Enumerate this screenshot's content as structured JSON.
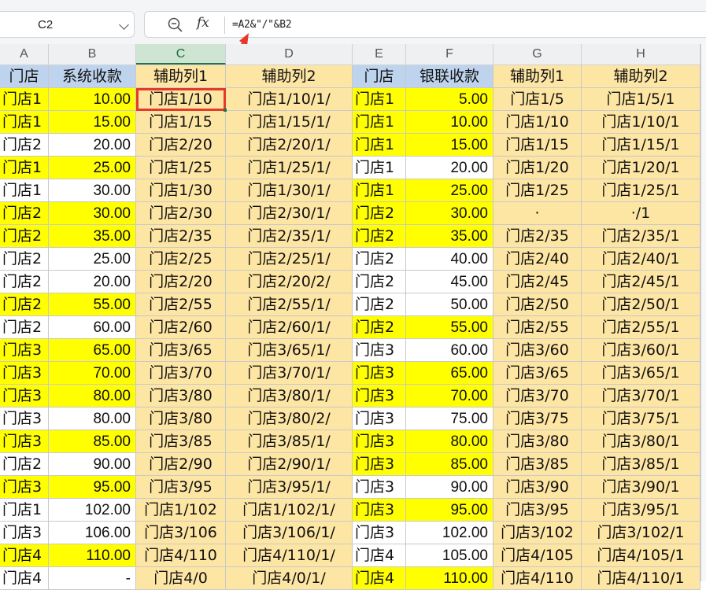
{
  "name_box": {
    "value": "C2"
  },
  "formula_bar": {
    "formula": "=A2&\"/\"&B2",
    "fx_label": "fx"
  },
  "columns": [
    "A",
    "B",
    "C",
    "D",
    "E",
    "F",
    "G",
    "H"
  ],
  "active_column": "C",
  "selected_cell": "C2",
  "header_row": [
    "门店",
    "系统收款",
    "辅助列1",
    "辅助列2",
    "门店",
    "银联收款",
    "辅助列1",
    "辅助列2"
  ],
  "rows": [
    {
      "a": "门店1",
      "b": "10.00",
      "c": "门店1/10",
      "d": "门店1/10/1/",
      "e": "门店1",
      "f": "5.00",
      "g": "门店1/5",
      "h": "门店1/5/1",
      "ya": true,
      "ye": true
    },
    {
      "a": "门店1",
      "b": "15.00",
      "c": "门店1/15",
      "d": "门店1/15/1/",
      "e": "门店1",
      "f": "10.00",
      "g": "门店1/10",
      "h": "门店1/10/1",
      "ya": true,
      "ye": true
    },
    {
      "a": "门店2",
      "b": "20.00",
      "c": "门店2/20",
      "d": "门店2/20/1/",
      "e": "门店1",
      "f": "15.00",
      "g": "门店1/15",
      "h": "门店1/15/1",
      "ya": false,
      "ye": true
    },
    {
      "a": "门店1",
      "b": "25.00",
      "c": "门店1/25",
      "d": "门店1/25/1/",
      "e": "门店1",
      "f": "20.00",
      "g": "门店1/20",
      "h": "门店1/20/1",
      "ya": true,
      "ye": false
    },
    {
      "a": "门店1",
      "b": "30.00",
      "c": "门店1/30",
      "d": "门店1/30/1/",
      "e": "门店1",
      "f": "25.00",
      "g": "门店1/25",
      "h": "门店1/25/1",
      "ya": false,
      "ye": true
    },
    {
      "a": "门店2",
      "b": "30.00",
      "c": "门店2/30",
      "d": "门店2/30/1/",
      "e": "门店2",
      "f": "30.00",
      "g": "·",
      "h": "·/1",
      "ya": true,
      "ye": true
    },
    {
      "a": "门店2",
      "b": "35.00",
      "c": "门店2/35",
      "d": "门店2/35/1/",
      "e": "门店2",
      "f": "35.00",
      "g": "门店2/35",
      "h": "门店2/35/1",
      "ya": true,
      "ye": true
    },
    {
      "a": "门店2",
      "b": "25.00",
      "c": "门店2/25",
      "d": "门店2/25/1/",
      "e": "门店2",
      "f": "40.00",
      "g": "门店2/40",
      "h": "门店2/40/1",
      "ya": false,
      "ye": false
    },
    {
      "a": "门店2",
      "b": "20.00",
      "c": "门店2/20",
      "d": "门店2/20/2/",
      "e": "门店2",
      "f": "45.00",
      "g": "门店2/45",
      "h": "门店2/45/1",
      "ya": false,
      "ye": false
    },
    {
      "a": "门店2",
      "b": "55.00",
      "c": "门店2/55",
      "d": "门店2/55/1/",
      "e": "门店2",
      "f": "50.00",
      "g": "门店2/50",
      "h": "门店2/50/1",
      "ya": true,
      "ye": false
    },
    {
      "a": "门店2",
      "b": "60.00",
      "c": "门店2/60",
      "d": "门店2/60/1/",
      "e": "门店2",
      "f": "55.00",
      "g": "门店2/55",
      "h": "门店2/55/1",
      "ya": false,
      "ye": true
    },
    {
      "a": "门店3",
      "b": "65.00",
      "c": "门店3/65",
      "d": "门店3/65/1/",
      "e": "门店3",
      "f": "60.00",
      "g": "门店3/60",
      "h": "门店3/60/1",
      "ya": true,
      "ye": false
    },
    {
      "a": "门店3",
      "b": "70.00",
      "c": "门店3/70",
      "d": "门店3/70/1/",
      "e": "门店3",
      "f": "65.00",
      "g": "门店3/65",
      "h": "门店3/65/1",
      "ya": true,
      "ye": true
    },
    {
      "a": "门店3",
      "b": "80.00",
      "c": "门店3/80",
      "d": "门店3/80/1/",
      "e": "门店3",
      "f": "70.00",
      "g": "门店3/70",
      "h": "门店3/70/1",
      "ya": true,
      "ye": true
    },
    {
      "a": "门店3",
      "b": "80.00",
      "c": "门店3/80",
      "d": "门店3/80/2/",
      "e": "门店3",
      "f": "75.00",
      "g": "门店3/75",
      "h": "门店3/75/1",
      "ya": false,
      "ye": false
    },
    {
      "a": "门店3",
      "b": "85.00",
      "c": "门店3/85",
      "d": "门店3/85/1/",
      "e": "门店3",
      "f": "80.00",
      "g": "门店3/80",
      "h": "门店3/80/1",
      "ya": true,
      "ye": true
    },
    {
      "a": "门店2",
      "b": "90.00",
      "c": "门店2/90",
      "d": "门店2/90/1/",
      "e": "门店3",
      "f": "85.00",
      "g": "门店3/85",
      "h": "门店3/85/1",
      "ya": false,
      "ye": true
    },
    {
      "a": "门店3",
      "b": "95.00",
      "c": "门店3/95",
      "d": "门店3/95/1/",
      "e": "门店3",
      "f": "90.00",
      "g": "门店3/90",
      "h": "门店3/90/1",
      "ya": true,
      "ye": false
    },
    {
      "a": "门店1",
      "b": "102.00",
      "c": "门店1/102",
      "d": "门店1/102/1/",
      "e": "门店3",
      "f": "95.00",
      "g": "门店3/95",
      "h": "门店3/95/1",
      "ya": false,
      "ye": true
    },
    {
      "a": "门店3",
      "b": "106.00",
      "c": "门店3/106",
      "d": "门店3/106/1/",
      "e": "门店3",
      "f": "102.00",
      "g": "门店3/102",
      "h": "门店3/102/1",
      "ya": false,
      "ye": false
    },
    {
      "a": "门店4",
      "b": "110.00",
      "c": "门店4/110",
      "d": "门店4/110/1/",
      "e": "门店4",
      "f": "105.00",
      "g": "门店4/105",
      "h": "门店4/105/1",
      "ya": true,
      "ye": false
    },
    {
      "a": "门店4",
      "b": "-",
      "c": "门店4/0",
      "d": "门店4/0/1/",
      "e": "门店4",
      "f": "110.00",
      "g": "门店4/110",
      "h": "门店4/110/1",
      "ya": false,
      "ye": true
    }
  ],
  "colors": {
    "yellow": "#ffff00",
    "helper_orange": "#fde5a4",
    "header_blue": "#bed4ee",
    "selection_red": "#e53a2a",
    "active_green": "#217346"
  }
}
